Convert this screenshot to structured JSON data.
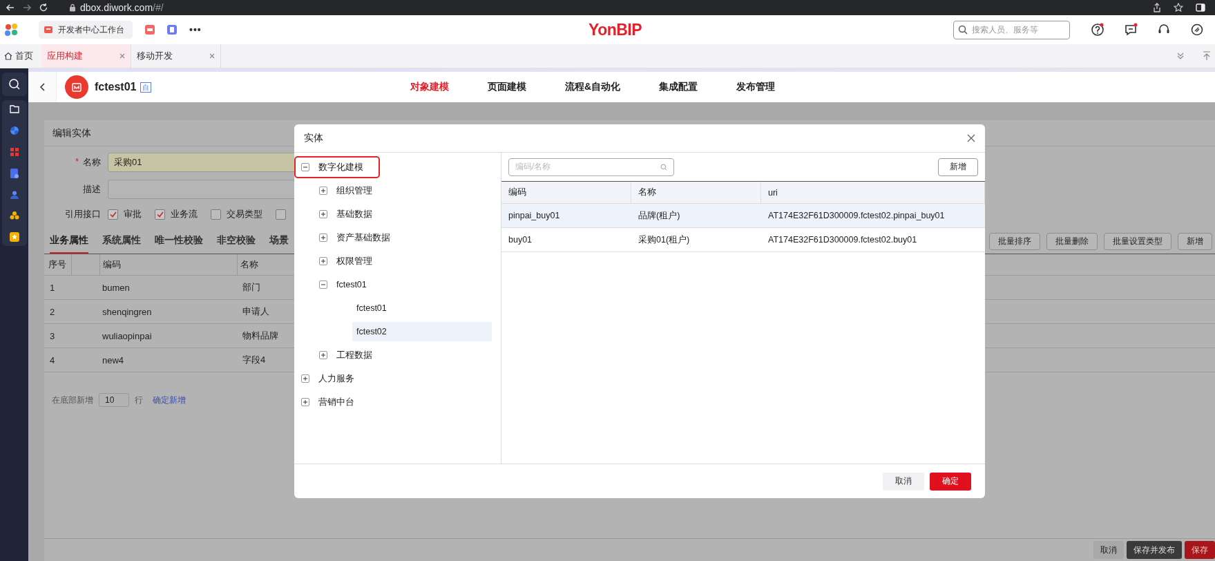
{
  "browser": {
    "url_host": "dbox.diwork.com",
    "url_path": "/#/"
  },
  "app_header": {
    "workspace_tab": "开发者中心工作台",
    "more": "•••",
    "logo": "YonBIP",
    "search": {
      "placeholder": "搜索人员、服务等"
    }
  },
  "tabs": [
    {
      "label": "首页",
      "kind": "home",
      "selected": false
    },
    {
      "label": "应用构建",
      "kind": "page",
      "selected": true
    },
    {
      "label": "移动开发",
      "kind": "page",
      "selected": false
    }
  ],
  "app": {
    "name": "fctest01",
    "badge": "自",
    "nav": [
      {
        "label": "对象建模",
        "selected": true
      },
      {
        "label": "页面建模",
        "selected": false
      },
      {
        "label": "流程&自动化",
        "selected": false
      },
      {
        "label": "集成配置",
        "selected": false
      },
      {
        "label": "发布管理",
        "selected": false
      }
    ]
  },
  "edit_dialog": {
    "title": "编辑实体",
    "fields": [
      {
        "label": "名称",
        "required_mark": "*",
        "value": "采购01"
      },
      {
        "label": "描述"
      }
    ],
    "interfaces": {
      "label": "引用接口",
      "options": [
        {
          "label": "审批",
          "checked": true
        },
        {
          "label": "业务流",
          "checked": true
        },
        {
          "label": "交易类型",
          "checked": false
        },
        {
          "checked": false
        }
      ]
    },
    "tabs": [
      {
        "label": "业务属性",
        "selected": true
      },
      {
        "label": "系统属性",
        "selected": false
      },
      {
        "label": "唯一性校验",
        "selected": false
      },
      {
        "label": "非空校验",
        "selected": false
      },
      {
        "label": "场景",
        "selected": false
      }
    ],
    "actions": [
      "批量排序",
      "批量删除",
      "批量设置类型",
      "新增"
    ],
    "table": {
      "columns": [
        "序号",
        "编码",
        "名称"
      ],
      "rows": [
        {
          "index": "1",
          "code": "bumen",
          "name": "部门"
        },
        {
          "index": "2",
          "code": "shenqingren",
          "name": "申请人"
        },
        {
          "index": "3",
          "code": "wuliaopinpai",
          "name": "物料品牌"
        },
        {
          "index": "4",
          "code": "new4",
          "name": "字段4"
        }
      ]
    },
    "add_rows": {
      "label": "在底部新增",
      "count": "10",
      "unit": "行",
      "link": "确定新增"
    },
    "footer": [
      {
        "label": "取消",
        "kind": "plain"
      },
      {
        "label": "保存并发布",
        "kind": "dark"
      },
      {
        "label": "保存",
        "kind": "primary"
      }
    ]
  },
  "entity_dialog": {
    "title": "实体",
    "tree": [
      {
        "label": "数字化建模",
        "expanded": true,
        "selected": false,
        "outlined": true,
        "children": [
          {
            "label": "组织管理",
            "expanded": false,
            "selected": false
          },
          {
            "label": "基础数据",
            "expanded": false,
            "selected": false
          },
          {
            "label": "资产基础数据",
            "expanded": false,
            "selected": false
          },
          {
            "label": "权限管理",
            "expanded": false,
            "selected": false
          },
          {
            "label": "fctest01",
            "expanded": true,
            "selected": false,
            "children": [
              {
                "label": "fctest01",
                "selected": false
              },
              {
                "label": "fctest02",
                "selected": true
              }
            ]
          },
          {
            "label": "工程数据",
            "expanded": false,
            "selected": false
          }
        ]
      },
      {
        "label": "人力服务",
        "expanded": false,
        "selected": false
      },
      {
        "label": "营销中台",
        "expanded": false,
        "selected": false
      }
    ],
    "search": {
      "placeholder": "编码/名称"
    },
    "add_button": "新增",
    "table": {
      "columns": [
        "编码",
        "名称",
        "uri"
      ],
      "rows": [
        {
          "code": "pinpai_buy01",
          "name": "品牌(租户)",
          "uri": "AT174E32F61D300009.fctest02.pinpai_buy01",
          "selected": true
        },
        {
          "code": "buy01",
          "name": "采购01(租户)",
          "uri": "AT174E32F61D300009.fctest02.buy01",
          "selected": false
        }
      ]
    },
    "buttons": [
      {
        "label": "取消",
        "kind": "secondary"
      },
      {
        "label": "确定",
        "kind": "primary"
      }
    ]
  }
}
